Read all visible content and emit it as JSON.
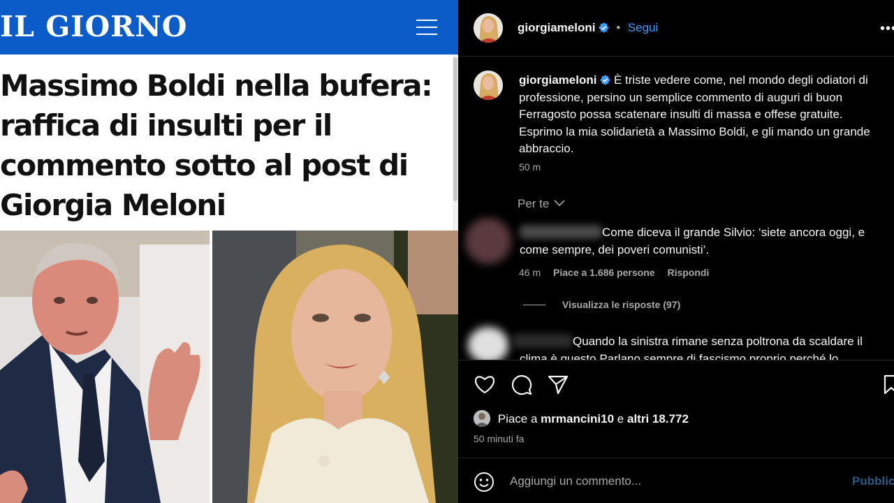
{
  "article": {
    "logo": "IL GIORNO",
    "headline": "Massimo Boldi nella bufera: raffica di insulti per il commento sotto al post di Giorgia Meloni",
    "brand_color": "#0b5bc9"
  },
  "post": {
    "username": "giorgiameloni",
    "header_dot": "•",
    "follow_label": "Segui",
    "more_icon": "more-horizontal-icon",
    "caption": "È triste vedere come, nel mondo degli odiatori di professione, persino un semplice commento di auguri di buon Ferragosto possa scatenare insulti di massa e offese gratuite. Esprimo la mia solidarietà a Massimo Boldi, e gli mando un grande abbraccio.",
    "caption_time": "50 m",
    "filter_label": "Per te"
  },
  "comments": [
    {
      "text": "Come diceva il grande Silvio: ‘siete ancora oggi, e come sempre, dei poveri comunisti’.",
      "time": "46 m",
      "likes": "Piace a 1.686 persone",
      "reply": "Rispondi",
      "view_replies": "Visualizza le risposte (97)"
    },
    {
      "text": "Quando la sinistra rimane senza poltrona da scaldare il clima è questo Parlano sempre di fascismo proprio perché lo"
    }
  ],
  "actions": {
    "liked_by_prefix": "Piace a",
    "liked_by_user": "mrmancini10",
    "liked_by_mid": "e",
    "liked_by_others": "altri 18.772",
    "post_time": "50 minuti fa"
  },
  "composer": {
    "placeholder": "Aggiungi un commento...",
    "publish_label": "Pubblica"
  },
  "colors": {
    "background": "#000000",
    "link": "#3d9bf6",
    "muted": "#a8a8a8",
    "verified": "#3d9bf6"
  }
}
